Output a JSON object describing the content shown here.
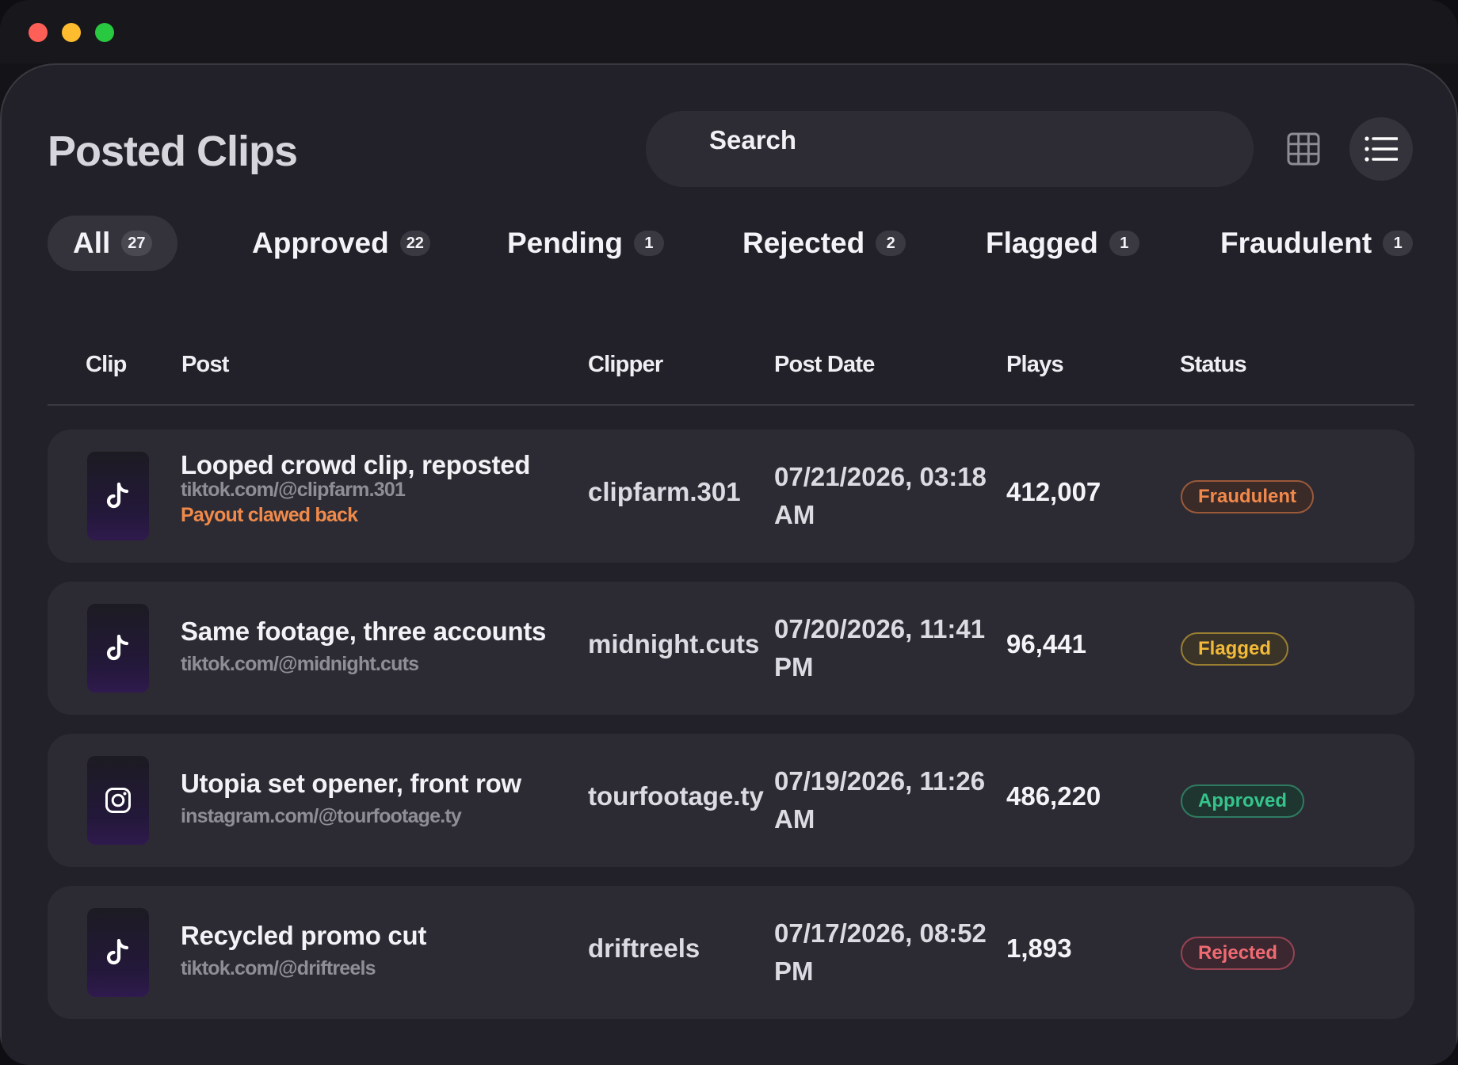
{
  "window": {
    "traffic_lights": [
      "close",
      "minimize",
      "zoom"
    ]
  },
  "header": {
    "title": "Posted Clips",
    "search_placeholder": "Search",
    "view_grid_icon": "grid-icon",
    "view_list_icon": "list-icon"
  },
  "tabs": [
    {
      "label": "All",
      "count": "27",
      "active": true
    },
    {
      "label": "Approved",
      "count": "22"
    },
    {
      "label": "Pending",
      "count": "1"
    },
    {
      "label": "Rejected",
      "count": "2"
    },
    {
      "label": "Flagged",
      "count": "1"
    },
    {
      "label": "Fraudulent",
      "count": "1"
    }
  ],
  "table": {
    "columns": [
      "Clip",
      "Post",
      "Clipper",
      "Post Date",
      "Plays",
      "Status"
    ],
    "rows": [
      {
        "platform_icon": "tiktok-icon",
        "title": "Looped crowd clip, reposted",
        "url": "tiktok.com/@clipfarm.301",
        "note": "Payout clawed back",
        "clipper": "clipfarm.301",
        "date": "07/21/2026, 03:18 AM",
        "plays": "412,007",
        "status": "Fraudulent"
      },
      {
        "platform_icon": "tiktok-icon",
        "title": "Same footage, three accounts",
        "url": "tiktok.com/@midnight.cuts",
        "clipper": "midnight.cuts",
        "date": "07/20/2026, 11:41 PM",
        "plays": "96,441",
        "status": "Flagged"
      },
      {
        "platform_icon": "instagram-icon",
        "title": "Utopia set opener, front row",
        "url": "instagram.com/@tourfootage.ty",
        "clipper": "tourfootage.ty",
        "date": "07/19/2026, 11:26 AM",
        "plays": "486,220",
        "status": "Approved"
      },
      {
        "platform_icon": "tiktok-icon",
        "title": "Recycled promo cut",
        "url": "tiktok.com/@driftreels",
        "clipper": "driftreels",
        "date": "07/17/2026, 08:52 PM",
        "plays": "1,893",
        "status": "Rejected"
      }
    ]
  },
  "colors": {
    "fraudulent": "#f2894b",
    "flagged": "#f3b938",
    "approved": "#35c48c",
    "rejected": "#f06a72",
    "note": "#f08a4b"
  }
}
